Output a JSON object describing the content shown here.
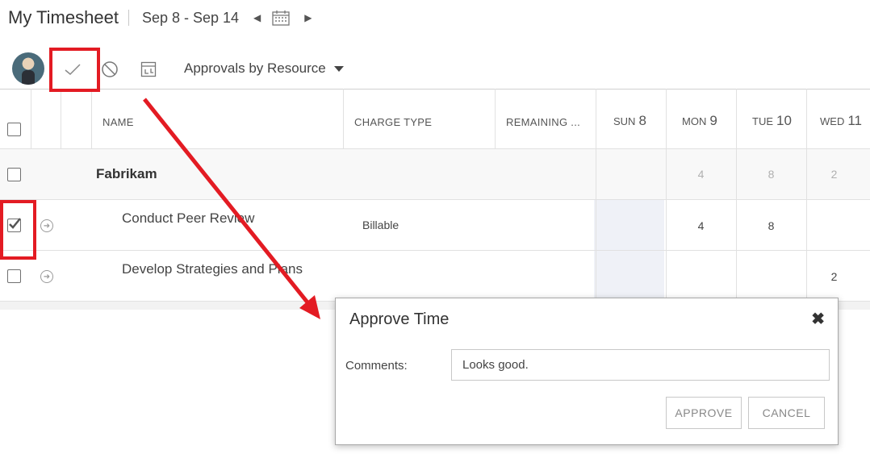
{
  "header": {
    "title": "My Timesheet",
    "date_range": "Sep 8 - Sep 14",
    "prev_glyph": "◀",
    "next_glyph": "▶"
  },
  "toolbar": {
    "view_dropdown": "Approvals by Resource"
  },
  "grid": {
    "columns": {
      "name": "NAME",
      "charge_type": "CHARGE TYPE",
      "remaining": "REMAINING ..."
    },
    "days": [
      {
        "dow": "SUN",
        "date": "8"
      },
      {
        "dow": "MON",
        "date": "9"
      },
      {
        "dow": "TUE",
        "date": "10"
      },
      {
        "dow": "WED",
        "date": "11"
      }
    ],
    "group": {
      "name": "Fabrikam",
      "mon": "4",
      "tue": "8",
      "wed": "2"
    },
    "rows": [
      {
        "task": "Conduct Peer Review",
        "charge_type": "Billable",
        "mon": "4",
        "tue": "8",
        "wed": ""
      },
      {
        "task": "Develop Strategies and Plans",
        "charge_type": "",
        "mon": "",
        "tue": "",
        "wed": "2"
      }
    ]
  },
  "dialog": {
    "title": "Approve Time",
    "close_glyph": "✖",
    "comments_label": "Comments:",
    "comments_value": "Looks good.",
    "approve_label": "APPROVE",
    "cancel_label": "CANCEL"
  },
  "colors": {
    "annotation_red": "#e31b23",
    "sunday_column": "#eff1f7"
  }
}
